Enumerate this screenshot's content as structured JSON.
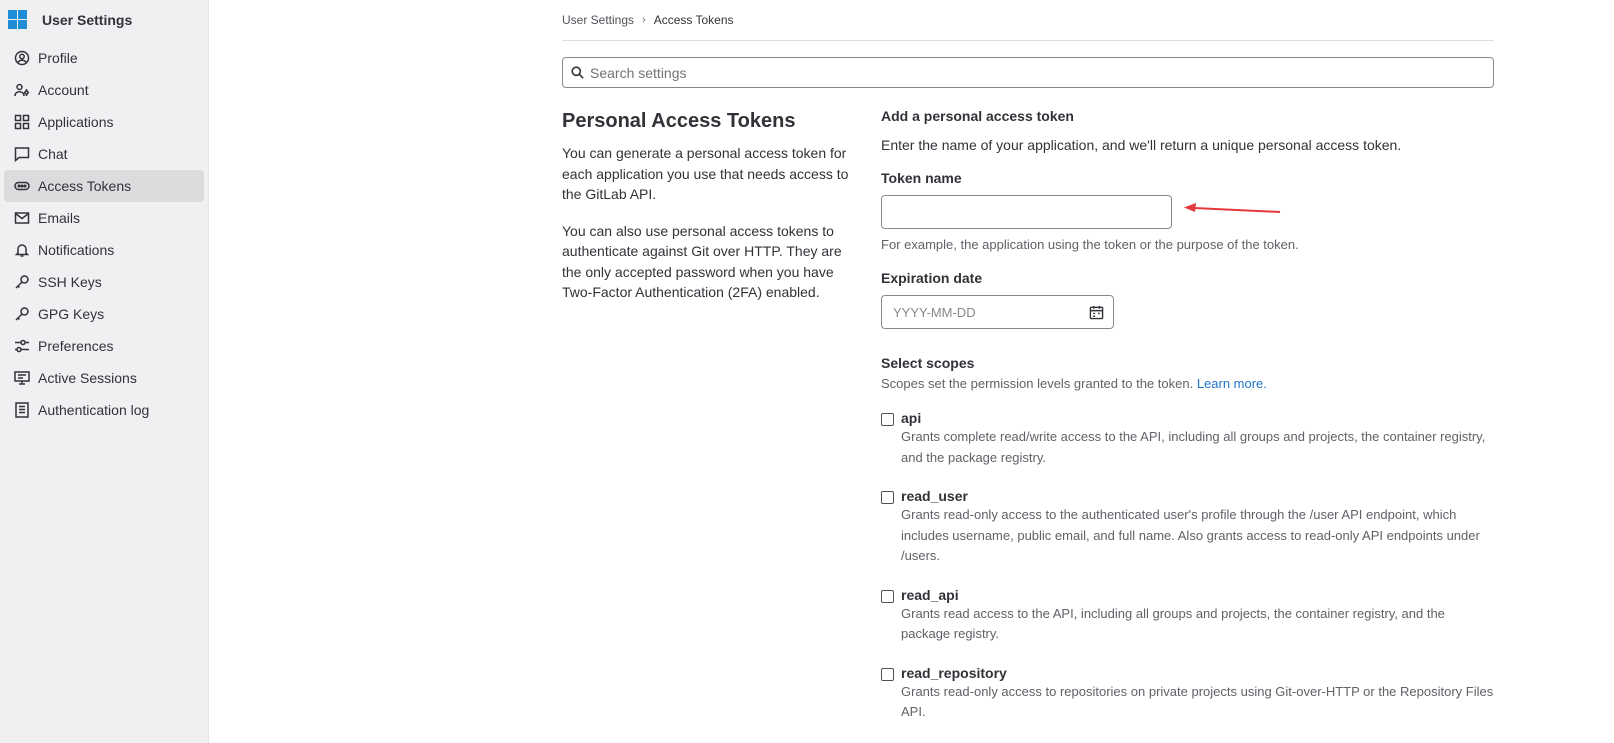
{
  "sidebar": {
    "title": "User Settings",
    "items": [
      {
        "label": "Profile",
        "icon": "profile-icon"
      },
      {
        "label": "Account",
        "icon": "account-icon"
      },
      {
        "label": "Applications",
        "icon": "applications-icon"
      },
      {
        "label": "Chat",
        "icon": "chat-icon"
      },
      {
        "label": "Access Tokens",
        "icon": "token-icon",
        "active": true
      },
      {
        "label": "Emails",
        "icon": "email-icon"
      },
      {
        "label": "Notifications",
        "icon": "bell-icon"
      },
      {
        "label": "SSH Keys",
        "icon": "key-icon"
      },
      {
        "label": "GPG Keys",
        "icon": "key-icon"
      },
      {
        "label": "Preferences",
        "icon": "preferences-icon"
      },
      {
        "label": "Active Sessions",
        "icon": "monitor-icon"
      },
      {
        "label": "Authentication log",
        "icon": "log-icon"
      }
    ]
  },
  "breadcrumb": {
    "root": "User Settings",
    "current": "Access Tokens"
  },
  "search": {
    "placeholder": "Search settings"
  },
  "intro": {
    "title": "Personal Access Tokens",
    "p1": "You can generate a personal access token for each application you use that needs access to the GitLab API.",
    "p2": "You can also use personal access tokens to authenticate against Git over HTTP. They are the only accepted password when you have Two-Factor Authentication (2FA) enabled."
  },
  "form": {
    "title": "Add a personal access token",
    "description": "Enter the name of your application, and we'll return a unique personal access token.",
    "token_name_label": "Token name",
    "token_name_value": "",
    "token_name_help": "For example, the application using the token or the purpose of the token.",
    "expiration_label": "Expiration date",
    "expiration_placeholder": "YYYY-MM-DD",
    "scopes_title": "Select scopes",
    "scopes_desc": "Scopes set the permission levels granted to the token.",
    "learn_more": "Learn more.",
    "scopes": [
      {
        "name": "api",
        "desc": "Grants complete read/write access to the API, including all groups and projects, the container registry, and the package registry."
      },
      {
        "name": "read_user",
        "desc": "Grants read-only access to the authenticated user's profile through the /user API endpoint, which includes username, public email, and full name. Also grants access to read-only API endpoints under /users."
      },
      {
        "name": "read_api",
        "desc": "Grants read access to the API, including all groups and projects, the container registry, and the package registry."
      },
      {
        "name": "read_repository",
        "desc": "Grants read-only access to repositories on private projects using Git-over-HTTP or the Repository Files API."
      }
    ]
  },
  "colors": {
    "sidebar_bg": "#f0f0f2",
    "link": "#1f75cb",
    "annotation_arrow": "#e5383b"
  }
}
